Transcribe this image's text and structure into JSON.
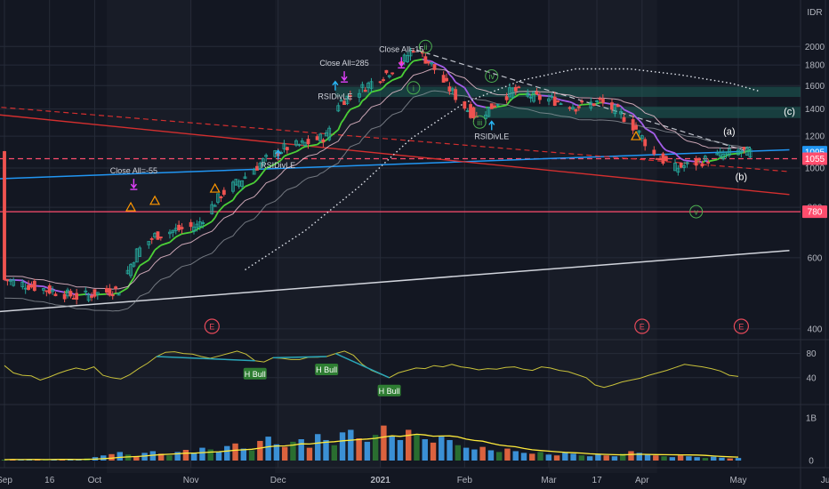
{
  "currency": "IDR",
  "colors": {
    "background": "#131722",
    "grid": "#262b38",
    "axis_text": "#b2b5be",
    "candle_up": "#26a69a",
    "candle_down": "#ef5350",
    "ema_up": "#4cd137",
    "ema_down": "#a55eea",
    "rsi_line": "#c8c13a",
    "div_line": "#2aa6b8",
    "blue_line": "#2196f3",
    "red_line": "#d32f2f",
    "pink_line": "#ff4d6d",
    "white_line": "#d1d4dc",
    "marker_magenta": "#e040fb",
    "marker_orange": "#ff9800",
    "marker_cyan": "#29b6f6",
    "zone": "#1e5e58",
    "wave_green": "#4caf50",
    "earnings": "#e64a5a"
  },
  "chart_data": [
    {
      "type": "candlestick",
      "scale": "log",
      "ylim": [
        380,
        2150
      ],
      "y_ticks": [
        400,
        600,
        800,
        1000,
        1200,
        1400,
        1600,
        1800,
        2000
      ],
      "x_ticks": [
        {
          "label": "Sep",
          "date": "2020-09-01"
        },
        {
          "label": "16",
          "date": "2020-09-16"
        },
        {
          "label": "Oct",
          "date": "2020-10-01"
        },
        {
          "label": "Nov",
          "date": "2020-11-02"
        },
        {
          "label": "Dec",
          "date": "2020-12-01"
        },
        {
          "label": "2021",
          "date": "2021-01-04",
          "bold": true
        },
        {
          "label": "Feb",
          "date": "2021-02-01"
        },
        {
          "label": "Mar",
          "date": "2021-03-01"
        },
        {
          "label": "17",
          "date": "2021-03-17"
        },
        {
          "label": "Apr",
          "date": "2021-04-01"
        },
        {
          "label": "May",
          "date": "2021-05-03"
        },
        {
          "label": "Ju",
          "date": "2021-06-01"
        }
      ],
      "price_path": [
        {
          "date": "2020-09-01",
          "price": 530
        },
        {
          "date": "2020-09-10",
          "price": 510
        },
        {
          "date": "2020-09-25",
          "price": 480
        },
        {
          "date": "2020-10-09",
          "price": 500
        },
        {
          "date": "2020-10-15",
          "price": 620
        },
        {
          "date": "2020-10-21",
          "price": 680
        },
        {
          "date": "2020-10-27",
          "price": 700
        },
        {
          "date": "2020-11-04",
          "price": 720
        },
        {
          "date": "2020-11-12",
          "price": 860
        },
        {
          "date": "2020-11-19",
          "price": 940
        },
        {
          "date": "2020-11-26",
          "price": 1040
        },
        {
          "date": "2020-12-03",
          "price": 1120
        },
        {
          "date": "2020-12-10",
          "price": 1150
        },
        {
          "date": "2020-12-17",
          "price": 1200
        },
        {
          "date": "2020-12-21",
          "price": 1450
        },
        {
          "date": "2020-12-28",
          "price": 1560
        },
        {
          "date": "2021-01-04",
          "price": 1680
        },
        {
          "date": "2021-01-11",
          "price": 1820
        },
        {
          "date": "2021-01-15",
          "price": 1990
        },
        {
          "date": "2021-01-21",
          "price": 1800
        },
        {
          "date": "2021-01-26",
          "price": 1600
        },
        {
          "date": "2021-02-01",
          "price": 1420
        },
        {
          "date": "2021-02-05",
          "price": 1330
        },
        {
          "date": "2021-02-10",
          "price": 1420
        },
        {
          "date": "2021-02-17",
          "price": 1560
        },
        {
          "date": "2021-02-24",
          "price": 1500
        },
        {
          "date": "2021-03-03",
          "price": 1470
        },
        {
          "date": "2021-03-10",
          "price": 1420
        },
        {
          "date": "2021-03-18",
          "price": 1460
        },
        {
          "date": "2021-03-24",
          "price": 1380
        },
        {
          "date": "2021-03-30",
          "price": 1250
        },
        {
          "date": "2021-04-05",
          "price": 1080
        },
        {
          "date": "2021-04-12",
          "price": 1000
        },
        {
          "date": "2021-04-19",
          "price": 1030
        },
        {
          "date": "2021-04-26",
          "price": 1070
        },
        {
          "date": "2021-05-03",
          "price": 1100
        },
        {
          "date": "2021-05-07",
          "price": 1095
        }
      ],
      "price_labels": [
        {
          "value": 1095,
          "label": "1095",
          "color": "#2196f3"
        },
        {
          "value": 1055,
          "label": "1055",
          "color": "#ff4d6d"
        },
        {
          "value": 780,
          "label": "780",
          "color": "#ff4d6d"
        }
      ],
      "horizontal_line": {
        "value": 780
      },
      "dashed_line": {
        "value": 1055
      },
      "trendlines": [
        {
          "name": "blue",
          "start": {
            "date": "2020-08-28",
            "price": 940
          },
          "end": {
            "date": "2021-05-20",
            "price": 1110
          }
        },
        {
          "name": "red",
          "start": {
            "date": "2020-08-28",
            "price": 1360
          },
          "end": {
            "date": "2021-05-20",
            "price": 860
          }
        },
        {
          "name": "red-dashed",
          "start": {
            "date": "2020-08-28",
            "price": 1420
          },
          "end": {
            "date": "2021-05-20",
            "price": 980
          }
        },
        {
          "name": "white",
          "start": {
            "date": "2020-08-28",
            "price": 440
          },
          "end": {
            "date": "2021-05-20",
            "price": 625
          }
        },
        {
          "name": "white-dashed",
          "start": {
            "date": "2021-01-16",
            "price": 1960
          },
          "end": {
            "date": "2021-05-06",
            "price": 1100
          }
        }
      ],
      "slow_ma": [
        {
          "date": "2020-11-20",
          "price": 560
        },
        {
          "date": "2020-12-10",
          "price": 700
        },
        {
          "date": "2020-12-28",
          "price": 900
        },
        {
          "date": "2021-01-14",
          "price": 1180
        },
        {
          "date": "2021-02-01",
          "price": 1450
        },
        {
          "date": "2021-02-20",
          "price": 1650
        },
        {
          "date": "2021-03-10",
          "price": 1760
        },
        {
          "date": "2021-03-28",
          "price": 1760
        },
        {
          "date": "2021-04-14",
          "price": 1700
        },
        {
          "date": "2021-05-01",
          "price": 1620
        },
        {
          "date": "2021-05-10",
          "price": 1550
        }
      ],
      "wave_labels": [
        {
          "text": "i",
          "date": "2021-01-15",
          "price": 1580,
          "circled": true
        },
        {
          "text": "ii",
          "date": "2021-01-19",
          "price": 2000,
          "circled": true
        },
        {
          "text": "iii",
          "date": "2021-02-06",
          "price": 1300,
          "circled": true
        },
        {
          "text": "iv",
          "date": "2021-02-10",
          "price": 1690,
          "circled": true
        },
        {
          "text": "v",
          "date": "2021-04-19",
          "price": 780,
          "circled": true
        },
        {
          "text": "(a)",
          "date": "2021-04-30",
          "price": 1230,
          "circled": false
        },
        {
          "text": "(b)",
          "date": "2021-05-04",
          "price": 950,
          "circled": false
        },
        {
          "text": "(c)",
          "date": "2021-05-20",
          "price": 1380,
          "circled": false
        }
      ],
      "signals": [
        {
          "text": "Close All=-55",
          "date": "2020-10-14",
          "price": 970,
          "kind": "exit"
        },
        {
          "text": "Close All=285",
          "date": "2020-12-23",
          "price": 1790,
          "kind": "exit"
        },
        {
          "text": "Close All=15",
          "date": "2021-01-11",
          "price": 1940,
          "kind": "exit"
        },
        {
          "text": "RSIDivLE",
          "date": "2020-12-20",
          "price": 1480,
          "kind": "entry"
        },
        {
          "text": "RSIDivLE",
          "date": "2020-12-01",
          "price": 1000,
          "kind": "entry"
        },
        {
          "text": "RSIDivLE",
          "date": "2021-02-10",
          "price": 1180,
          "kind": "entry"
        }
      ],
      "warnings": [
        {
          "date": "2020-10-13",
          "price": 800
        },
        {
          "date": "2020-10-21",
          "price": 830
        },
        {
          "date": "2020-11-10",
          "price": 890
        },
        {
          "date": "2021-03-30",
          "price": 1200
        }
      ],
      "earnings": [
        {
          "label": "E",
          "date": "2020-11-09"
        },
        {
          "label": "E",
          "date": "2021-04-01"
        },
        {
          "label": "E",
          "date": "2021-05-04"
        }
      ]
    },
    {
      "type": "line",
      "name": "RSI",
      "ylim": [
        0,
        100
      ],
      "y_ticks": [
        40,
        80
      ],
      "values": [
        60,
        48,
        44,
        43,
        36,
        41,
        47,
        52,
        56,
        53,
        58,
        44,
        40,
        38,
        45,
        55,
        64,
        75,
        82,
        83,
        80,
        79,
        75,
        72,
        76,
        80,
        84,
        79,
        68,
        66,
        73,
        72,
        70,
        70,
        74,
        74,
        75,
        80,
        84,
        77,
        62,
        52,
        46,
        40,
        48,
        52,
        56,
        55,
        60,
        58,
        62,
        58,
        56,
        53,
        55,
        54,
        57,
        58,
        54,
        52,
        58,
        56,
        52,
        50,
        45,
        40,
        28,
        24,
        28,
        33,
        36,
        39,
        44,
        48,
        52,
        57,
        62,
        60,
        58,
        55,
        51,
        44,
        42
      ],
      "divergences": [
        {
          "label": "H Bull",
          "from": 17,
          "to": 28
        },
        {
          "label": "H Bull",
          "from": 30,
          "to": 36
        },
        {
          "label": "H Bull",
          "from": 37,
          "to": 43
        }
      ]
    },
    {
      "type": "bar",
      "name": "Volume",
      "y_ticks": [
        {
          "value": 0,
          "label": "0"
        },
        {
          "value": 1,
          "label": "1B"
        }
      ],
      "values": [
        0.02,
        0.03,
        0.02,
        0.03,
        0.02,
        0.02,
        0.03,
        0.04,
        0.03,
        0.02,
        0.05,
        0.08,
        0.12,
        0.15,
        0.2,
        0.14,
        0.1,
        0.18,
        0.22,
        0.16,
        0.12,
        0.2,
        0.25,
        0.18,
        0.3,
        0.26,
        0.2,
        0.34,
        0.4,
        0.28,
        0.24,
        0.46,
        0.56,
        0.38,
        0.32,
        0.44,
        0.5,
        0.3,
        0.62,
        0.48,
        0.36,
        0.66,
        0.72,
        0.52,
        0.44,
        0.6,
        0.82,
        0.58,
        0.48,
        0.72,
        0.62,
        0.5,
        0.42,
        0.56,
        0.48,
        0.36,
        0.3,
        0.26,
        0.32,
        0.24,
        0.2,
        0.28,
        0.22,
        0.18,
        0.16,
        0.2,
        0.14,
        0.12,
        0.18,
        0.16,
        0.12,
        0.1,
        0.14,
        0.12,
        0.1,
        0.16,
        0.22,
        0.18,
        0.14,
        0.12,
        0.1,
        0.08,
        0.12,
        0.1,
        0.08,
        0.06,
        0.09,
        0.07,
        0.05,
        0.06
      ]
    }
  ]
}
